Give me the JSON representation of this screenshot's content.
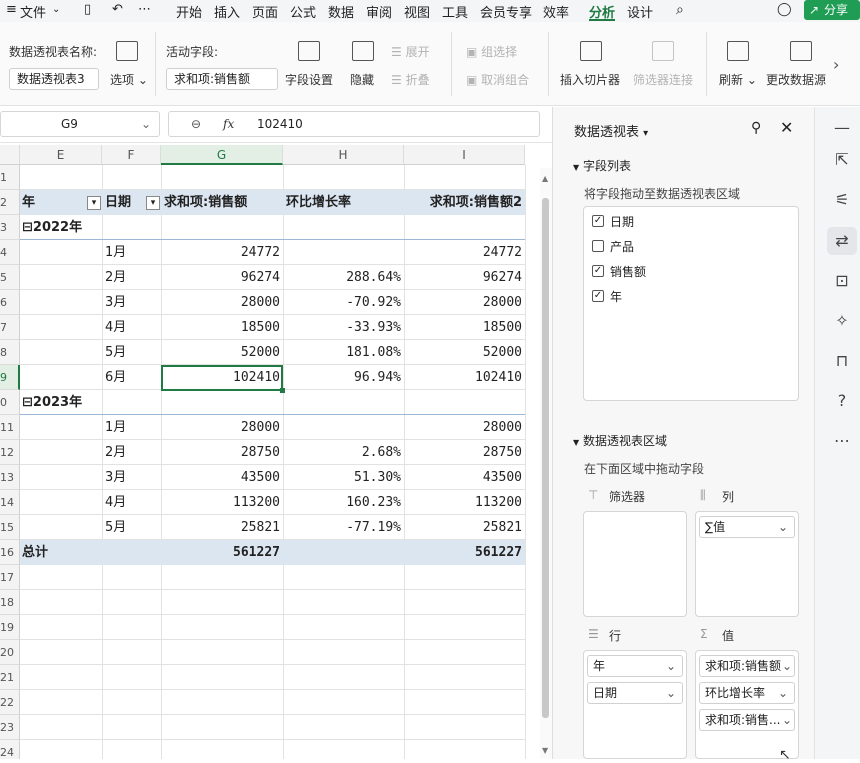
{
  "menubar": {
    "file": "文件",
    "items": [
      "开始",
      "插入",
      "页面",
      "公式",
      "数据",
      "审阅",
      "视图",
      "工具",
      "会员专享",
      "效率",
      "分析",
      "设计"
    ],
    "active": "分析",
    "share": "分享"
  },
  "ribbon": {
    "pivot_name_label": "数据透视表名称:",
    "pivot_name_value": "数据透视表3",
    "options_label": "选项",
    "active_field_label": "活动字段:",
    "active_field_value": "求和项:销售额",
    "field_settings": "字段设置",
    "hide": "隐藏",
    "expand": "展开",
    "collapse": "折叠",
    "group_selection": "组选择",
    "ungroup": "取消组合",
    "insert_slicer": "插入切片器",
    "filter_connections": "筛选器连接",
    "refresh": "刷新",
    "change_source": "更改数据源"
  },
  "formula_bar": {
    "cell_ref": "G9",
    "fx": "fx",
    "value": "102410"
  },
  "grid": {
    "columns": [
      "E",
      "F",
      "G",
      "H",
      "I"
    ],
    "selected_column": "G",
    "rows": [
      "1",
      "2",
      "3",
      "4",
      "5",
      "6",
      "7",
      "8",
      "9",
      "0",
      "11",
      "12",
      "13",
      "14",
      "15",
      "16",
      "17",
      "18",
      "19",
      "20",
      "21",
      "22",
      "23",
      "24"
    ],
    "selected_row": "9",
    "headers": {
      "year": "年",
      "date": "日期",
      "sum_sales": "求和项:销售额",
      "mom": "环比增长率",
      "sum_sales2": "求和项:销售额2"
    },
    "groups": [
      {
        "label": "⊟2022年",
        "items": [
          {
            "month": "1月",
            "sales": "24772",
            "mom": "",
            "sales2": "24772"
          },
          {
            "month": "2月",
            "sales": "96274",
            "mom": "288.64%",
            "sales2": "96274"
          },
          {
            "month": "3月",
            "sales": "28000",
            "mom": "-70.92%",
            "sales2": "28000"
          },
          {
            "month": "4月",
            "sales": "18500",
            "mom": "-33.93%",
            "sales2": "18500"
          },
          {
            "month": "5月",
            "sales": "52000",
            "mom": "181.08%",
            "sales2": "52000"
          },
          {
            "month": "6月",
            "sales": "102410",
            "mom": "96.94%",
            "sales2": "102410"
          }
        ]
      },
      {
        "label": "⊟2023年",
        "items": [
          {
            "month": "1月",
            "sales": "28000",
            "mom": "",
            "sales2": "28000"
          },
          {
            "month": "2月",
            "sales": "28750",
            "mom": "2.68%",
            "sales2": "28750"
          },
          {
            "month": "3月",
            "sales": "43500",
            "mom": "51.30%",
            "sales2": "43500"
          },
          {
            "month": "4月",
            "sales": "113200",
            "mom": "160.23%",
            "sales2": "113200"
          },
          {
            "month": "5月",
            "sales": "25821",
            "mom": "-77.19%",
            "sales2": "25821"
          }
        ]
      }
    ],
    "total": {
      "label": "总计",
      "sales": "561227",
      "sales2": "561227"
    }
  },
  "panel": {
    "title": "数据透视表",
    "field_list_title": "字段列表",
    "field_list_hint": "将字段拖动至数据透视表区域",
    "fields": [
      {
        "name": "日期",
        "checked": true
      },
      {
        "name": "产品",
        "checked": false
      },
      {
        "name": "销售额",
        "checked": true
      },
      {
        "name": "年",
        "checked": true
      }
    ],
    "areas_title": "数据透视表区域",
    "areas_hint": "在下面区域中拖动字段",
    "filter_label": "筛选器",
    "columns_label": "列",
    "rows_label": "行",
    "values_label": "值",
    "columns_chips": [
      "∑值"
    ],
    "rows_chips": [
      "年",
      "日期"
    ],
    "values_chips": [
      "求和项:销售额",
      "环比增长率",
      "求和项:销售..."
    ]
  },
  "colors": {
    "accent": "#1f7a44",
    "band": "#dce6f1",
    "share": "#1f9d55"
  }
}
